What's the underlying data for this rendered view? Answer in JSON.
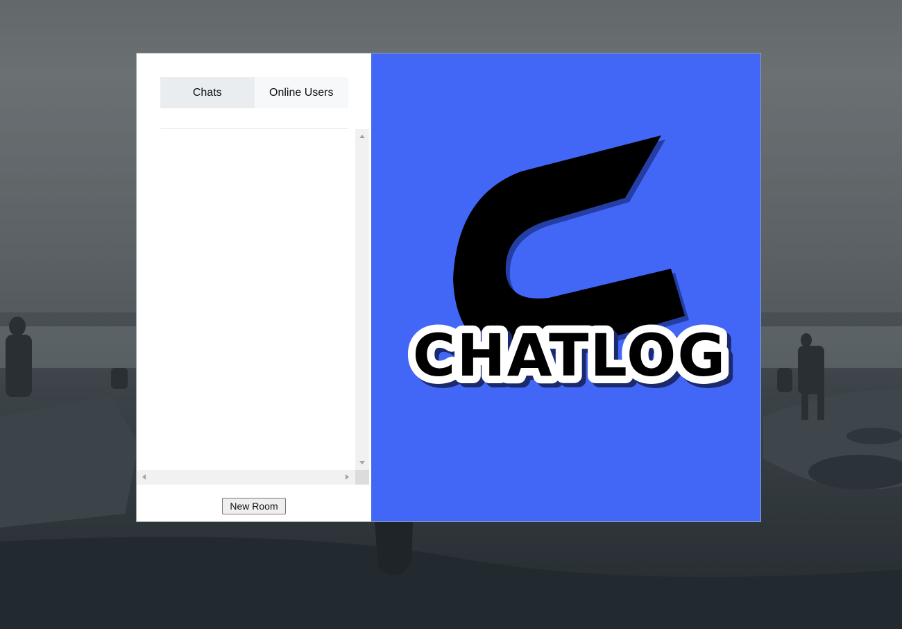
{
  "tabs": [
    {
      "label": "Chats",
      "active": true
    },
    {
      "label": "Online Users",
      "active": false
    }
  ],
  "actions": {
    "new_room_label": "New Room"
  },
  "logo": {
    "text": "CHATLOG",
    "icon": "c-logo-icon"
  },
  "colors": {
    "logo_background": "#4267f7",
    "tab_active": "#eaedf0",
    "tab_inactive": "#f7f8f9"
  }
}
